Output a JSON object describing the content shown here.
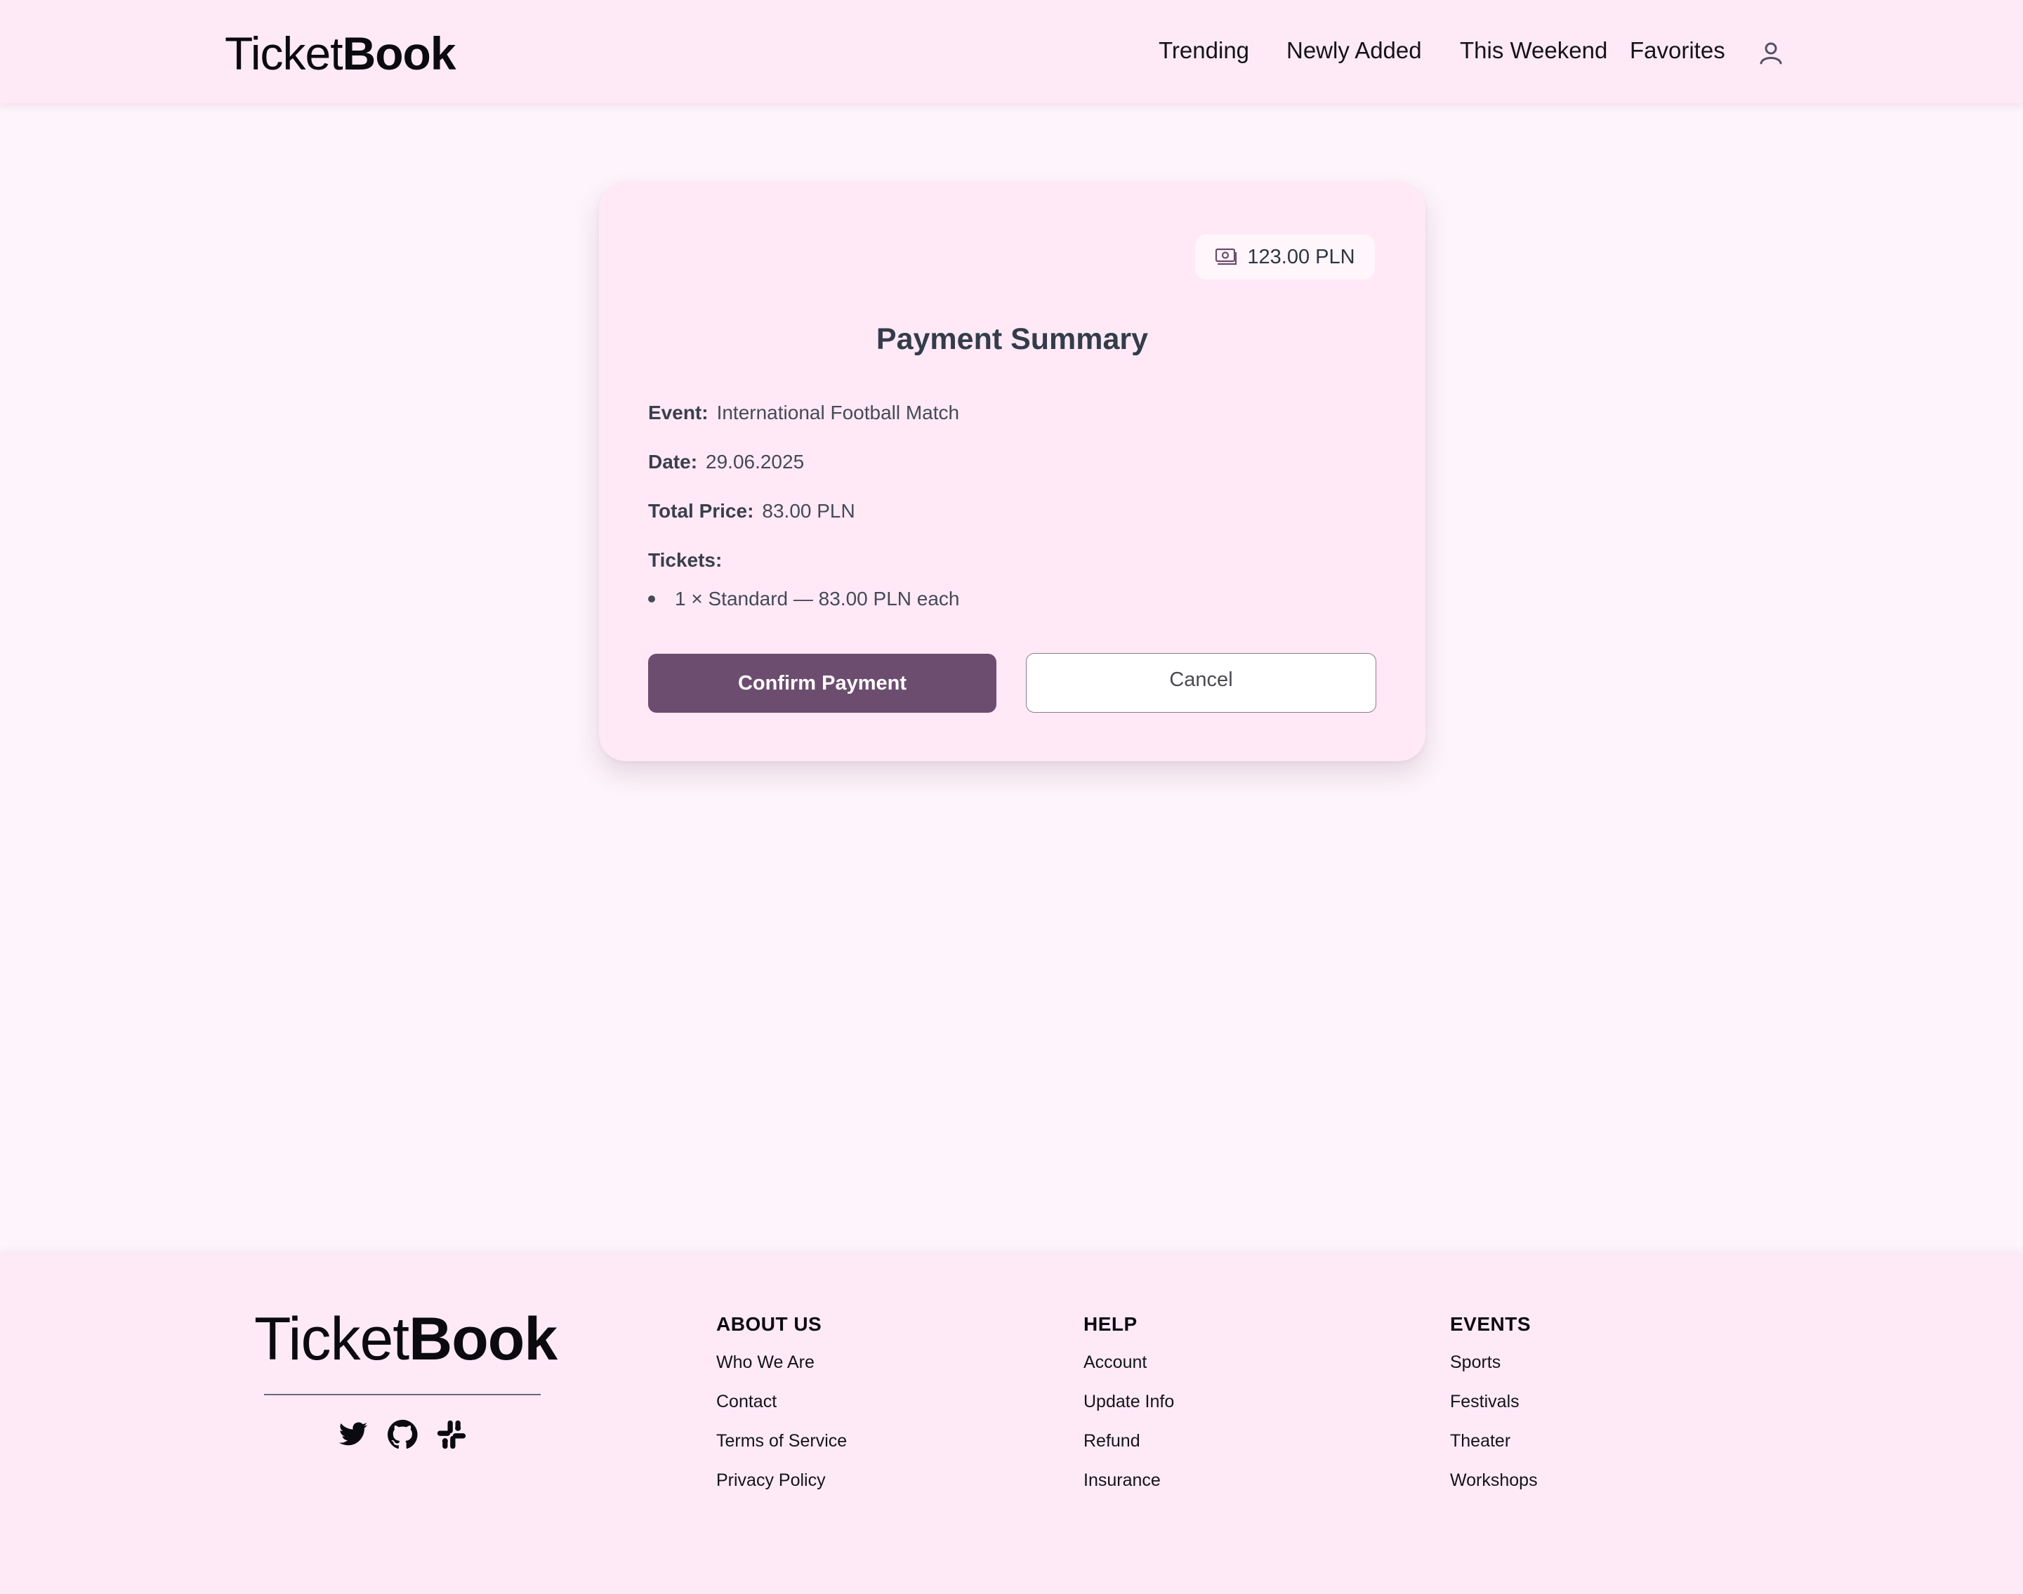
{
  "header": {
    "logo_light": "Ticket",
    "logo_bold": "Book",
    "nav": [
      "Trending",
      "Newly Added",
      "This Weekend",
      "Favorites"
    ]
  },
  "card": {
    "badge_amount": "123.00 PLN",
    "title": "Payment Summary",
    "event_label": "Event:",
    "event_value": "International Football Match",
    "date_label": "Date:",
    "date_value": "29.06.2025",
    "total_label": "Total Price:",
    "total_value": "83.00 PLN",
    "tickets_label": "Tickets:",
    "tickets": [
      "1 × Standard — 83.00 PLN each"
    ],
    "confirm_label": "Confirm Payment",
    "cancel_label": "Cancel"
  },
  "footer": {
    "logo_light": "Ticket",
    "logo_bold": "Book",
    "social_icons": [
      "twitter-icon",
      "github-icon",
      "slack-icon"
    ],
    "columns": [
      {
        "heading": "ABOUT US",
        "links": [
          "Who We Are",
          "Contact",
          "Terms of Service",
          "Privacy Policy"
        ]
      },
      {
        "heading": "HELP",
        "links": [
          "Account",
          "Update Info",
          "Refund",
          "Insurance"
        ]
      },
      {
        "heading": "EVENTS",
        "links": [
          "Sports",
          "Festivals",
          "Theater",
          "Workshops"
        ]
      }
    ]
  },
  "colors": {
    "page_bg": "#fef4fb",
    "header_bg": "#feeaf7",
    "card_bg": "#ffe9f7",
    "accent": "#6c4d6f"
  }
}
